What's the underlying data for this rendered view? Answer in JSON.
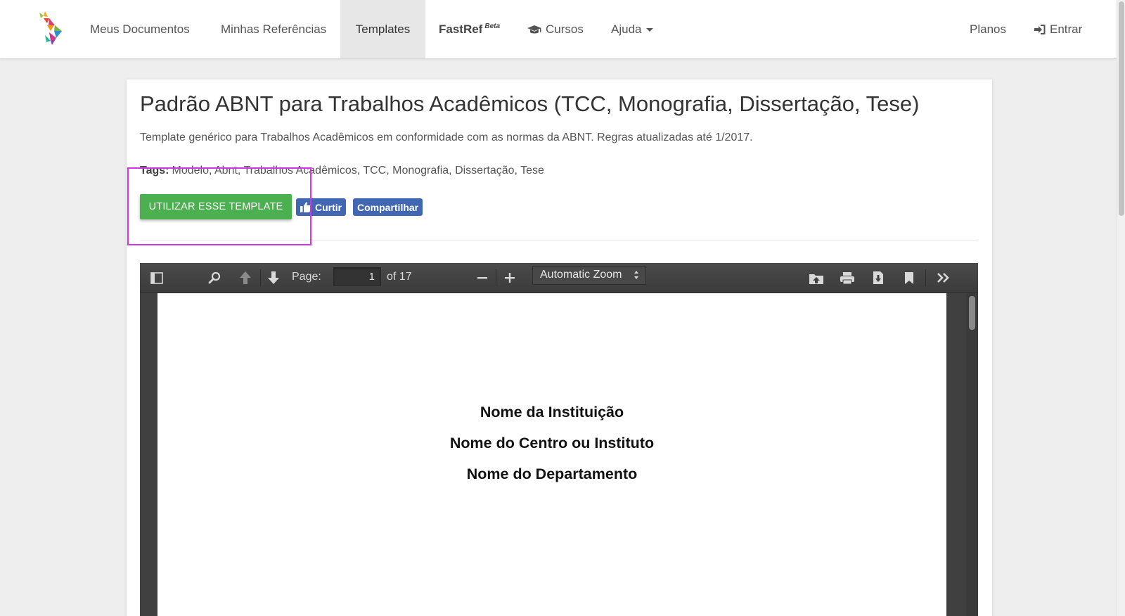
{
  "navbar": {
    "items": [
      {
        "label": "Meus Documentos"
      },
      {
        "label": "Minhas Referências"
      },
      {
        "label": "Templates"
      },
      {
        "label": "FastRef",
        "sup": "Beta"
      },
      {
        "label": "Cursos",
        "icon": "graduation-cap-icon"
      },
      {
        "label": "Ajuda"
      }
    ],
    "right": [
      {
        "label": "Planos"
      },
      {
        "label": "Entrar",
        "icon": "sign-in-icon"
      }
    ]
  },
  "template": {
    "title": "Padrão ABNT para Trabalhos Acadêmicos (TCC, Monografia, Dissertação, Tese)",
    "description": "Template genérico para Trabalhos Acadêmicos em conformidade com as normas da ABNT. Regras atualizadas até 1/2017.",
    "tags_label": "Tags:",
    "tags": "Modelo, Abnt, Trabalhos Acadêmicos, TCC, Monografia, Dissertação, Tese",
    "use_button": "UTILIZAR ESSE TEMPLATE",
    "like_button": "Curtir",
    "share_button": "Compartilhar"
  },
  "viewer": {
    "page_label": "Page:",
    "page_value": "1",
    "page_total": "of 17",
    "zoom": "Automatic Zoom",
    "pdf_lines": [
      "Nome da Instituição",
      "Nome do Centro ou Instituto",
      "Nome do Departamento"
    ]
  },
  "colors": {
    "use_button": "#4caf50",
    "facebook": "#4267b2",
    "highlight": "#d633e8",
    "viewer_bg": "#404040"
  }
}
